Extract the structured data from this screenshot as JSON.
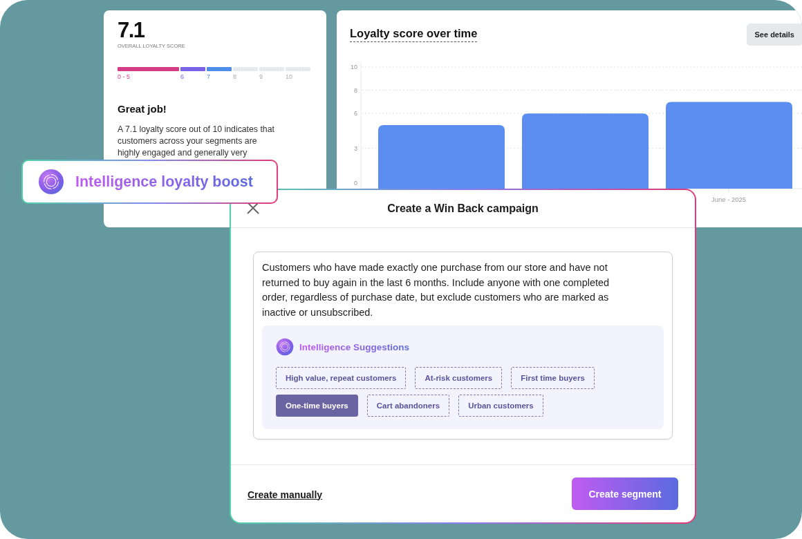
{
  "score_card": {
    "score": "7.1",
    "score_label": "OVERALL LOYALTY SCORE",
    "scale": [
      {
        "label": "0 - 5",
        "filled": true,
        "color": "#d63c86"
      },
      {
        "label": "6",
        "filled": true,
        "color": "#7a63e6"
      },
      {
        "label": "7",
        "filled": true,
        "color": "#4f8ee8"
      },
      {
        "label": "8",
        "filled": false,
        "color": "#e9ebef"
      },
      {
        "label": "9",
        "filled": false,
        "color": "#e9ebef"
      },
      {
        "label": "10",
        "filled": false,
        "color": "#e9ebef"
      }
    ],
    "heading": "Great job!",
    "description": "A 7.1 loyalty score out of 10 indicates that customers across your segments are highly engaged and generally very"
  },
  "chart_card": {
    "title": "Loyalty score over time",
    "button": "See details",
    "chart_data": {
      "type": "bar",
      "categories": [
        null,
        null,
        "June - 2025"
      ],
      "values": [
        5,
        6,
        7
      ],
      "ylim": [
        0,
        10
      ],
      "grid": true,
      "yticks": [
        0,
        3,
        6,
        8,
        10
      ]
    }
  },
  "badge": {
    "label": "Intelligence loyalty boost"
  },
  "dialog": {
    "title": "Create a Win Back campaign",
    "prompt": {
      "value": "Customers who have made exactly one purchase from our store and have not returned to buy again in the last 6 months. Include anyone with one completed order, regardless of purchase date, but exclude customers who are marked as inactive or unsubscribed."
    },
    "suggestions": {
      "title": "Intelligence Suggestions",
      "chips": [
        {
          "label": "High value, repeat customers",
          "selected": false
        },
        {
          "label": "At-risk customers",
          "selected": false
        },
        {
          "label": "First time buyers",
          "selected": false
        },
        {
          "label": "One-time buyers",
          "selected": true
        },
        {
          "label": "Cart abandoners",
          "selected": false
        },
        {
          "label": "Urban customers",
          "selected": false
        }
      ]
    },
    "secondary_action": "Create manually",
    "primary_action": "Create segment"
  }
}
